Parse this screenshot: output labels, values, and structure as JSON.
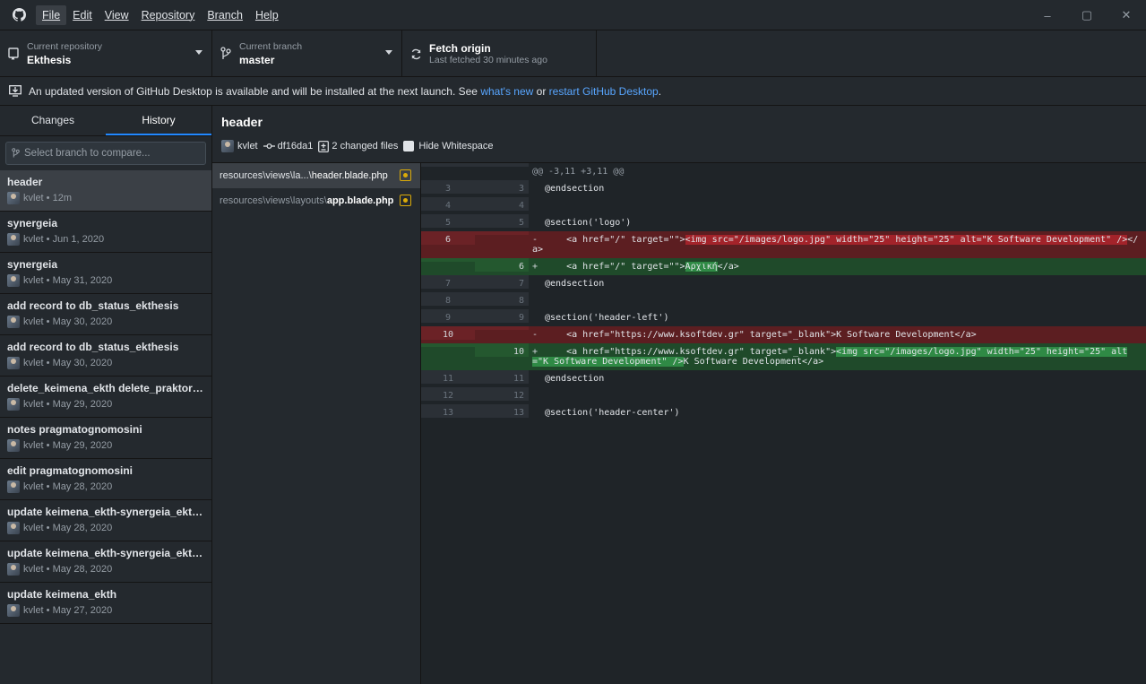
{
  "titlebar": {
    "menu": [
      {
        "label": "File",
        "active": true
      },
      {
        "label": "Edit"
      },
      {
        "label": "View"
      },
      {
        "label": "Repository"
      },
      {
        "label": "Branch"
      },
      {
        "label": "Help"
      }
    ],
    "minimize": "–",
    "restore": "▢",
    "close": "✕"
  },
  "toolbar": {
    "repo_sub": "Current repository",
    "repo_name": "Ekthesis",
    "branch_sub": "Current branch",
    "branch_name": "master",
    "fetch_title": "Fetch origin",
    "fetch_sub": "Last fetched 30 minutes ago"
  },
  "banner": {
    "text": "An updated version of GitHub Desktop is available and will be installed at the next launch. See ",
    "link1": "what's new",
    "mid": " or ",
    "link2": "restart GitHub Desktop",
    "end": "."
  },
  "sidebar": {
    "tabs": [
      "Changes",
      "History"
    ],
    "active_tab": "History",
    "compare_placeholder": "Select branch to compare...",
    "commits": [
      {
        "title": "header",
        "author": "kvlet",
        "time": "12m"
      },
      {
        "title": "synergeia",
        "author": "kvlet",
        "time": "Jun 1, 2020"
      },
      {
        "title": "synergeia",
        "author": "kvlet",
        "time": "May 31, 2020"
      },
      {
        "title": "add record to db_status_ekthesis",
        "author": "kvlet",
        "time": "May 30, 2020"
      },
      {
        "title": "add record to db_status_ekthesis",
        "author": "kvlet",
        "time": "May 30, 2020"
      },
      {
        "title": "delete_keimena_ekth delete_praktorei...",
        "author": "kvlet",
        "time": "May 29, 2020"
      },
      {
        "title": "notes pragmatognomosini",
        "author": "kvlet",
        "time": "May 29, 2020"
      },
      {
        "title": "edit pragmatognomosini",
        "author": "kvlet",
        "time": "May 28, 2020"
      },
      {
        "title": "update keimena_ekth-synergeia_ekth-...",
        "author": "kvlet",
        "time": "May 28, 2020"
      },
      {
        "title": "update keimena_ekth-synergeia_ekth-...",
        "author": "kvlet",
        "time": "May 28, 2020"
      },
      {
        "title": "update keimena_ekth",
        "author": "kvlet",
        "time": "May 27, 2020"
      }
    ]
  },
  "commit_header": {
    "title": "header",
    "author": "kvlet",
    "sha": "df16da1",
    "changed_files": "2 changed files",
    "hide_whitespace": "Hide Whitespace"
  },
  "files": [
    {
      "dir": "resources\\views\\la...\\",
      "name": "header.blade.php"
    },
    {
      "dir": "resources\\views\\layouts\\",
      "name": "app.blade.php"
    }
  ],
  "diff": {
    "hunk": "@@ -3,11 +3,11 @@",
    "lines": [
      {
        "o": "3",
        "n": "3",
        "t": "ctx",
        "code": "@endsection"
      },
      {
        "o": "4",
        "n": "4",
        "t": "ctx",
        "code": ""
      },
      {
        "o": "5",
        "n": "5",
        "t": "ctx",
        "code": "@section('logo')"
      },
      {
        "o": "6",
        "n": "",
        "t": "del",
        "pre": "    <a href=\"/\" target=\"\">",
        "hl": "<img src=\"/images/logo.jpg\" width=\"25\" height=\"25\" alt=\"K Software Development\" />",
        "post": "</a>"
      },
      {
        "o": "",
        "n": "6",
        "t": "add",
        "pre": "    <a href=\"/\" target=\"\">",
        "hl": "Αρχική",
        "post": "</a>"
      },
      {
        "o": "7",
        "n": "7",
        "t": "ctx",
        "code": "@endsection"
      },
      {
        "o": "8",
        "n": "8",
        "t": "ctx",
        "code": ""
      },
      {
        "o": "9",
        "n": "9",
        "t": "ctx",
        "code": "@section('header-left')"
      },
      {
        "o": "10",
        "n": "",
        "t": "del",
        "pre": "    <a href=\"https://www.ksoftdev.gr\" target=\"_blank\">K Software Development</a>",
        "hl": "",
        "post": ""
      },
      {
        "o": "",
        "n": "10",
        "t": "add",
        "pre": "    <a href=\"https://www.ksoftdev.gr\" target=\"_blank\">",
        "hl": "<img src=\"/images/logo.jpg\" width=\"25\" height=\"25\" alt=\"K Software Development\" />",
        "post": "K Software Development</a>"
      },
      {
        "o": "11",
        "n": "11",
        "t": "ctx",
        "code": "@endsection"
      },
      {
        "o": "12",
        "n": "12",
        "t": "ctx",
        "code": ""
      },
      {
        "o": "13",
        "n": "13",
        "t": "ctx",
        "code": "@section('header-center')"
      }
    ]
  }
}
